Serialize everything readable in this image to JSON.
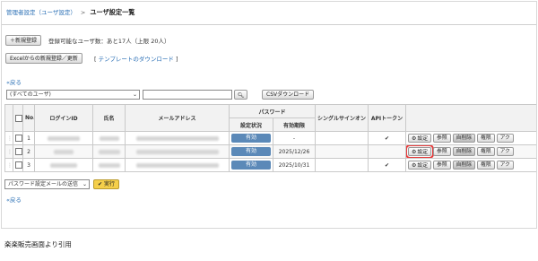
{
  "breadcrumb": {
    "parent": "管理者設定（ユーザ設定）",
    "separator": ">",
    "current": "ユーザ設定一覧"
  },
  "toolbar": {
    "new_button": "新規登録",
    "register_info": "登録可能なユーザ数：あと17人（上限 20人）",
    "excel_button": "Excelからの新規登録／更新",
    "template_open": "[",
    "template_link": "テンプレートのダウンロード",
    "template_close": "]"
  },
  "back_link": "«戻る",
  "filter": {
    "selected": "(すべてのユーザ)",
    "search_value": "",
    "csv_button": "CSVダウンロード"
  },
  "table": {
    "headers": {
      "no": "No.",
      "login": "ログインID",
      "name": "氏名",
      "mail": "メールアドレス",
      "password_group": "パスワード",
      "pw_status": "設定状況",
      "pw_expiry": "有効期限",
      "sso": "シングルサインオン",
      "api": "APIトークン"
    },
    "rows": [
      {
        "no": "1",
        "status": "有効",
        "expiry": "-",
        "api": "✔"
      },
      {
        "no": "2",
        "status": "有効",
        "expiry": "2025/12/26",
        "api": ""
      },
      {
        "no": "3",
        "status": "有効",
        "expiry": "2025/10/31",
        "api": "✔"
      }
    ],
    "actions": {
      "settings": "設定",
      "view": "参照",
      "delete": "自削除",
      "permission": "権限",
      "access": "アク"
    }
  },
  "footer": {
    "bulk_select": "パスワード設定メールの送信",
    "exec_button": "実行",
    "back_link": "«戻る"
  },
  "caption": "楽楽販売画面より引用",
  "colors": {
    "link": "#2a6fb5",
    "status_pill": "#5b89b8",
    "highlight": "#e63b3b",
    "exec": "#f5cf4a"
  }
}
